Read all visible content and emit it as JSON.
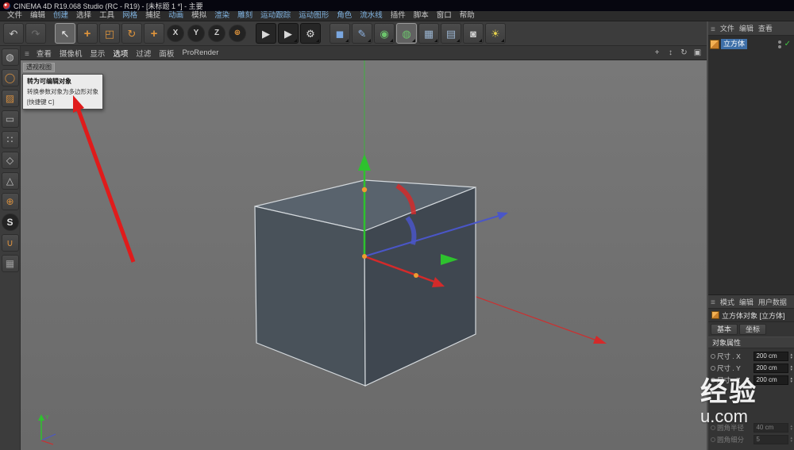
{
  "colors": {
    "axis-green": "#2ec22e",
    "axis-red": "#d42a2a",
    "axis-blue": "#4a56c8",
    "cube-top": "#59636d",
    "cube-left": "#49525a",
    "cube-right": "#3f4750",
    "cube-edge": "#d4d9dd",
    "annotation-red": "#e01b1b",
    "accent-orange": "#e0953c",
    "selection-blue": "#3e6fa8"
  },
  "title_bar": {
    "title": "CINEMA 4D R19.068 Studio (RC - R19) - [未标题 1 *] - 主要"
  },
  "menu_bar": {
    "items": [
      {
        "name": "menu-file",
        "label": "文件",
        "tinted": false
      },
      {
        "name": "menu-edit",
        "label": "编辑",
        "tinted": false
      },
      {
        "name": "menu-create",
        "label": "创建",
        "tinted": true
      },
      {
        "name": "menu-select",
        "label": "选择",
        "tinted": false
      },
      {
        "name": "menu-tools",
        "label": "工具",
        "tinted": false
      },
      {
        "name": "menu-mesh",
        "label": "网格",
        "tinted": true
      },
      {
        "name": "menu-snap",
        "label": "捕捉",
        "tinted": false
      },
      {
        "name": "menu-animate",
        "label": "动画",
        "tinted": true
      },
      {
        "name": "menu-simulate",
        "label": "模拟",
        "tinted": false
      },
      {
        "name": "menu-render",
        "label": "渲染",
        "tinted": true
      },
      {
        "name": "menu-sculpt",
        "label": "雕刻",
        "tinted": true
      },
      {
        "name": "menu-motion-tracker",
        "label": "运动跟踪",
        "tinted": true
      },
      {
        "name": "menu-mograph",
        "label": "运动图形",
        "tinted": true
      },
      {
        "name": "menu-character",
        "label": "角色",
        "tinted": true
      },
      {
        "name": "menu-pipeline",
        "label": "流水线",
        "tinted": true
      },
      {
        "name": "menu-plugins",
        "label": "插件",
        "tinted": false
      },
      {
        "name": "menu-script",
        "label": "脚本",
        "tinted": false
      },
      {
        "name": "menu-window",
        "label": "窗口",
        "tinted": false
      },
      {
        "name": "menu-help",
        "label": "帮助",
        "tinted": false
      }
    ]
  },
  "toolbar": {
    "buttons": [
      {
        "name": "undo-button",
        "glyph": "↶",
        "color": "#c9c9c9"
      },
      {
        "name": "redo-button",
        "glyph": "↷",
        "color": "#6f6f6f"
      },
      {
        "name": "live-selection-tool",
        "glyph": "↖",
        "color": "#f0f0f0",
        "sep": true,
        "selected": true
      },
      {
        "name": "move-tool",
        "glyph": "+",
        "color": "#e0953c",
        "bold": true
      },
      {
        "name": "scale-tool",
        "glyph": "◰",
        "color": "#e0953c"
      },
      {
        "name": "rotate-tool",
        "glyph": "↻",
        "color": "#e0953c"
      },
      {
        "name": "last-used-tool",
        "glyph": "+",
        "color": "#e0953c",
        "bold": true
      },
      {
        "name": "lock-x-axis-button",
        "glyph": "X",
        "color": "#d0d0d0",
        "round": true,
        "sep": true
      },
      {
        "name": "lock-y-axis-button",
        "glyph": "Y",
        "color": "#d0d0d0",
        "round": true
      },
      {
        "name": "lock-z-axis-button",
        "glyph": "Z",
        "color": "#d0d0d0",
        "round": true
      },
      {
        "name": "coordinate-system-button",
        "glyph": "⊕",
        "color": "#e0953c",
        "round": true
      },
      {
        "name": "render-view-button",
        "glyph": "▶",
        "color": "#d8d8d8",
        "dark": true,
        "sep": true
      },
      {
        "name": "render-picture-viewer-button",
        "glyph": "▶",
        "color": "#d8d8d8",
        "dark": true,
        "dropdown": true
      },
      {
        "name": "render-settings-button",
        "glyph": "⚙",
        "color": "#d8d8d8",
        "dark": true,
        "dropdown": true
      },
      {
        "name": "primitive-cube-button",
        "glyph": "◼",
        "color": "#7aa7e0",
        "sep": true,
        "dropdown": true
      },
      {
        "name": "spline-pen-button",
        "glyph": "✎",
        "color": "#8fb6e8",
        "dropdown": true
      },
      {
        "name": "subdivision-surface-button",
        "glyph": "◉",
        "color": "#6cc46c",
        "dropdown": true
      },
      {
        "name": "generator-button",
        "glyph": "◍",
        "color": "#6cc46c",
        "dropdown": true,
        "selected": true
      },
      {
        "name": "cloner-button",
        "glyph": "▦",
        "color": "#9ab4d0",
        "dropdown": true
      },
      {
        "name": "environment-button",
        "glyph": "▤",
        "color": "#9ab4d0",
        "dropdown": true
      },
      {
        "name": "camera-button",
        "glyph": "◙",
        "color": "#cfcfcf",
        "dropdown": true
      },
      {
        "name": "light-button",
        "glyph": "☀",
        "color": "#e8d44d",
        "dropdown": true
      }
    ]
  },
  "left_toolbar": {
    "buttons": [
      {
        "name": "make-editable-button",
        "glyph": "◍",
        "color": "#c8c8c8"
      },
      {
        "name": "model-mode-button",
        "glyph": "◯",
        "color": "#d89040"
      },
      {
        "name": "texture-mode-button",
        "glyph": "▨",
        "color": "#d89040"
      },
      {
        "name": "workplane-mode-button",
        "glyph": "▭",
        "color": "#b8b8b8"
      },
      {
        "name": "points-mode-button",
        "glyph": "∷",
        "color": "#c8c8c8"
      },
      {
        "name": "edges-mode-button",
        "glyph": "◇",
        "color": "#c8c8c8"
      },
      {
        "name": "polygons-mode-button",
        "glyph": "△",
        "color": "#c8c8c8"
      },
      {
        "name": "enable-axis-button",
        "glyph": "⊕",
        "color": "#d89040"
      },
      {
        "name": "snap-toggle-button",
        "glyph": "S",
        "color": "#e0e0e0",
        "round": true
      },
      {
        "name": "snap-magnet-button",
        "glyph": "∪",
        "color": "#d89040"
      },
      {
        "name": "workplane-lock-button",
        "glyph": "▦",
        "color": "#9a9a9a"
      }
    ]
  },
  "viewport": {
    "menu": [
      {
        "name": "vp-menu-view",
        "label": "查看",
        "bright": false
      },
      {
        "name": "vp-menu-cameras",
        "label": "摄像机",
        "bright": false
      },
      {
        "name": "vp-menu-display",
        "label": "显示",
        "bright": false
      },
      {
        "name": "vp-menu-options",
        "label": "选项",
        "bright": true
      },
      {
        "name": "vp-menu-filter",
        "label": "过滤",
        "bright": false
      },
      {
        "name": "vp-menu-panel",
        "label": "面板",
        "bright": false
      },
      {
        "name": "vp-menu-prorender",
        "label": "ProRender",
        "bright": false
      }
    ],
    "controls": [
      {
        "name": "pan-view-icon",
        "glyph": "+"
      },
      {
        "name": "zoom-view-icon",
        "glyph": "↕"
      },
      {
        "name": "rotate-view-icon",
        "glyph": "↻"
      },
      {
        "name": "toggle-view-icon",
        "glyph": "▣"
      }
    ],
    "view_label": "透视视图",
    "tooltip": {
      "title": "转为可编辑对象",
      "description": "转换参数对象为多边形对象",
      "shortcut": "[快捷键 C]"
    },
    "axis_labels": {
      "x": "X",
      "y": "Y",
      "z": "Z"
    }
  },
  "object_manager": {
    "menu": [
      {
        "name": "om-menu-file",
        "label": "文件"
      },
      {
        "name": "om-menu-edit",
        "label": "编辑"
      },
      {
        "name": "om-menu-view",
        "label": "查看"
      }
    ],
    "objects": [
      {
        "name": "cube-object-row",
        "label": "立方体",
        "check": "✓"
      }
    ]
  },
  "attribute_manager": {
    "menu": [
      {
        "name": "am-menu-mode",
        "label": "模式"
      },
      {
        "name": "am-menu-edit",
        "label": "编辑"
      },
      {
        "name": "am-menu-userdata",
        "label": "用户数据"
      }
    ],
    "object_title": "立方体对象 [立方体]",
    "tabs": [
      {
        "name": "am-tab-basic",
        "label": "基本"
      },
      {
        "name": "am-tab-coordinates",
        "label": "坐标"
      }
    ],
    "section_title": "对象属性",
    "rows": [
      {
        "name": "size-x-field",
        "label": "尺寸 . X",
        "value": "200 cm"
      },
      {
        "name": "size-y-field",
        "label": "尺寸 . Y",
        "value": "200 cm"
      },
      {
        "name": "size-z-field",
        "label": "尺寸 . Z",
        "value": "200 cm"
      }
    ],
    "disabled_rows": [
      {
        "name": "fillet-radius-field",
        "label": "圆角半径",
        "value": "40 cm"
      },
      {
        "name": "fillet-subdivision-field",
        "label": "圆角细分",
        "value": "5"
      }
    ]
  },
  "watermark": {
    "line1": "经验",
    "line2": "u.com"
  }
}
